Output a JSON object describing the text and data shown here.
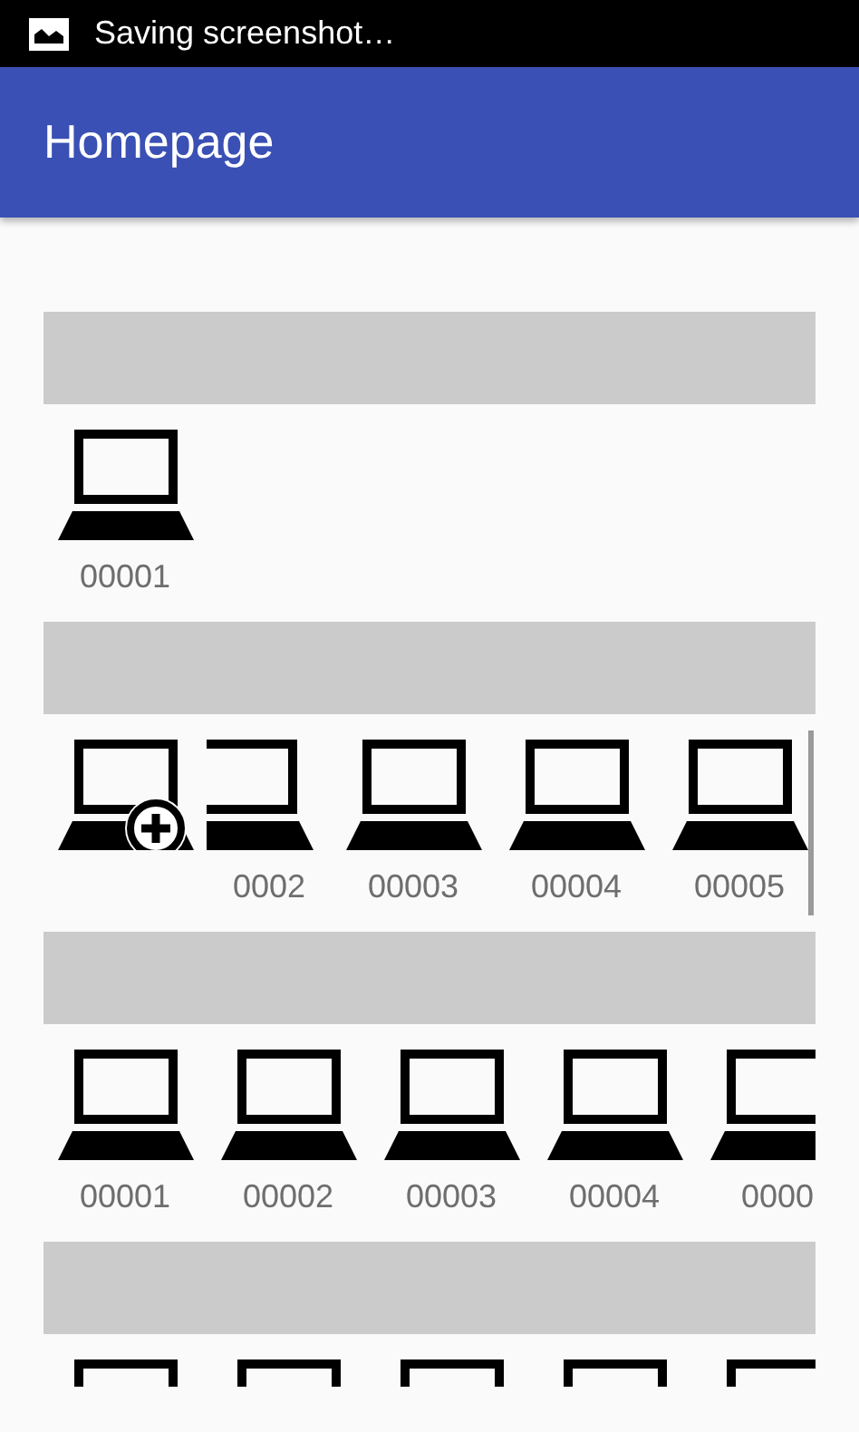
{
  "status_bar": {
    "text": "Saving screenshot…"
  },
  "app_bar": {
    "title": "Homepage"
  },
  "sections": [
    {
      "items": [
        {
          "kind": "device",
          "label": "00001"
        }
      ]
    },
    {
      "scroll_bar": true,
      "items": [
        {
          "kind": "add"
        },
        {
          "kind": "device-cut",
          "label": "0002"
        },
        {
          "kind": "device",
          "label": "00003"
        },
        {
          "kind": "device",
          "label": "00004"
        },
        {
          "kind": "device",
          "label": "00005"
        }
      ]
    },
    {
      "items": [
        {
          "kind": "device",
          "label": "00001"
        },
        {
          "kind": "device",
          "label": "00002"
        },
        {
          "kind": "device",
          "label": "00003"
        },
        {
          "kind": "device",
          "label": "00004"
        },
        {
          "kind": "device",
          "label": "0000"
        }
      ]
    },
    {
      "items": [
        {
          "kind": "device"
        },
        {
          "kind": "device"
        },
        {
          "kind": "device"
        },
        {
          "kind": "device"
        },
        {
          "kind": "device"
        }
      ]
    }
  ]
}
